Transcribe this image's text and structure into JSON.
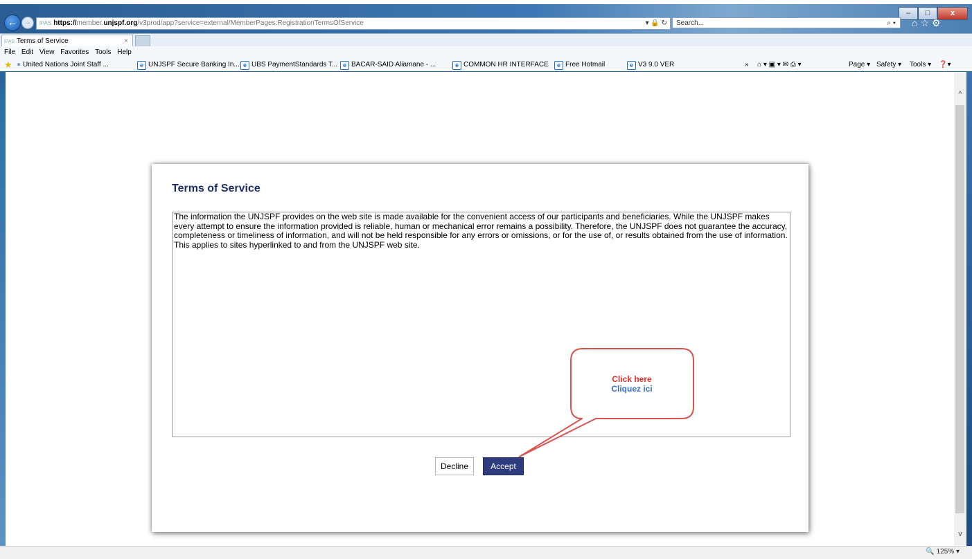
{
  "browser": {
    "url_prefix": "https://",
    "url_domain_pre": "member.",
    "url_domain": "unjspf.org",
    "url_path": "/v3prod/app?service=external/MemberPages:RegistrationTermsOfService",
    "url_tag": "iPAS",
    "search_placeholder": "Search...",
    "tab_title": "Terms of Service",
    "tab_tag": "iPAS",
    "window_min": "–",
    "window_max": "□",
    "window_close": "x"
  },
  "menu": [
    "File",
    "Edit",
    "View",
    "Favorites",
    "Tools",
    "Help"
  ],
  "favorites": [
    "United Nations Joint Staff ...",
    "UNJSPF Secure Banking In...",
    "UBS PaymentStandards T...",
    "BACAR-SAID Aliamane - ...",
    "COMMON HR INTERFACE",
    "Free Hotmail",
    "V3 9.0 VER"
  ],
  "command_bar": {
    "overflow": "»",
    "page": "Page ▾",
    "safety": "Safety ▾",
    "tools": "Tools ▾"
  },
  "dialog": {
    "title": "Terms of Service",
    "body": "The information the UNJSPF provides on the web site is made available for the convenient access of our participants and beneficiaries. While the UNJSPF makes every attempt to ensure the information provided is reliable, human or mechanical error remains a possibility. Therefore, the UNJSPF does not guarantee the accuracy, completeness or timeliness of information, and will not be held responsible for any errors or omissions, or for the use of, or results obtained from the use of information. This applies to sites hyperlinked to and from the UNJSPF web site.",
    "decline_label": "Decline",
    "accept_label": "Accept"
  },
  "callout": {
    "line1": "Click here",
    "line2": "Cliquez ici",
    "colors": {
      "border": "#d9534f",
      "line1": "#e0322a",
      "line2": "#3a6fc9"
    }
  },
  "status": {
    "zoom": "125%"
  },
  "colors": {
    "title": "#1f2f66",
    "accept_bg": "#2e3c7f"
  }
}
